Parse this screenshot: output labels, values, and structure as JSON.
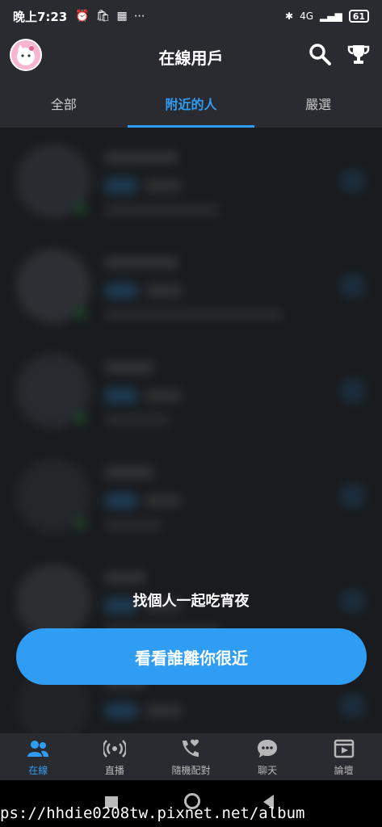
{
  "status_bar": {
    "time": "晚上7:23",
    "icons_left": [
      "alarm-icon",
      "shopee-icon",
      "news-icon",
      "more-dots-icon"
    ],
    "network": "4G",
    "battery": "61"
  },
  "header": {
    "title": "在線用戶",
    "avatar_icon": "cat-avatar-icon",
    "search_icon": "search-icon",
    "trophy_icon": "trophy-icon"
  },
  "tabs": [
    {
      "label": "全部",
      "active": false
    },
    {
      "label": "附近的人",
      "active": true
    },
    {
      "label": "嚴選",
      "active": false
    }
  ],
  "promo": {
    "text": "找個人一起吃宵夜",
    "button_label": "看看誰離你很近"
  },
  "bottom_nav": [
    {
      "label": "在線",
      "icon": "users-icon",
      "active": true
    },
    {
      "label": "直播",
      "icon": "broadcast-icon",
      "active": false
    },
    {
      "label": "隨機配對",
      "icon": "heart-phone-icon",
      "active": false
    },
    {
      "label": "聊天",
      "icon": "chat-bubble-icon",
      "active": false
    },
    {
      "label": "論壇",
      "icon": "forum-icon",
      "active": false
    }
  ],
  "watermark": "ps://hhdie0208tw.pixnet.net/album",
  "colors": {
    "accent": "#2f9df4",
    "online": "#26b34a",
    "background": "#212226",
    "bar": "#2a2b30"
  }
}
